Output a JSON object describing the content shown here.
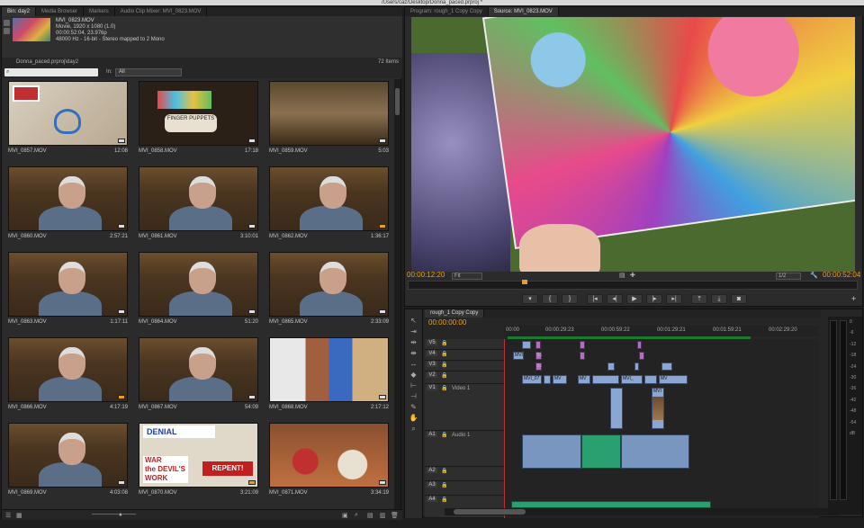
{
  "titlebar": {
    "path": "/Users/caz/Desktop/Donna_paced.prproj *"
  },
  "project_panel": {
    "tabs": [
      "Bin: day2",
      "Media Browser",
      "Markers",
      "Audio Clip Mixer: MVI_0823.MOV"
    ],
    "clip_info": {
      "name": "MVI_0823.MOV",
      "line1": "Movie, 1920 x 1080 (1.0)",
      "line2": "00:00:52:04, 23.976p",
      "line3": "48000 Hz - 16-bit - Stereo mapped to 2 Mono"
    },
    "path": "Donna_paced.prproj\\day2",
    "item_count": "72 Items",
    "search_placeholder": "",
    "in_label": "In:",
    "filter_value": "All",
    "clips": [
      {
        "name": "MVI_0857.MOV",
        "duration": "12:08",
        "kind": "sign"
      },
      {
        "name": "MVI_0858.MOV",
        "duration": "17:18",
        "kind": "puppets"
      },
      {
        "name": "MVI_0859.MOV",
        "duration": "5:03",
        "kind": "shelf"
      },
      {
        "name": "MVI_0860.MOV",
        "duration": "2:57:21",
        "kind": "face"
      },
      {
        "name": "MVI_0861.MOV",
        "duration": "3:10:01",
        "kind": "face"
      },
      {
        "name": "MVI_0862.MOV",
        "duration": "1:36:17",
        "kind": "face"
      },
      {
        "name": "MVI_0863.MOV",
        "duration": "1:17:11",
        "kind": "face"
      },
      {
        "name": "MVI_0864.MOV",
        "duration": "51:20",
        "kind": "face"
      },
      {
        "name": "MVI_0865.MOV",
        "duration": "2:33:09",
        "kind": "face"
      },
      {
        "name": "MVI_0866.MOV",
        "duration": "4:17:19",
        "kind": "face"
      },
      {
        "name": "MVI_0867.MOV",
        "duration": "54:09",
        "kind": "face"
      },
      {
        "name": "MVI_0868.MOV",
        "duration": "2:17:12",
        "kind": "window"
      },
      {
        "name": "MVI_0869.MOV",
        "duration": "4:03:08",
        "kind": "face"
      },
      {
        "name": "MVI_0870.MOV",
        "duration": "3:21:09",
        "kind": "signs"
      },
      {
        "name": "MVI_0871.MOV",
        "duration": "3:34:19",
        "kind": "baskets"
      }
    ],
    "sign_text": {
      "denial": "DENIAL",
      "war": "WAR",
      "devils": "the DEVIL'S",
      "work": "WORK",
      "repent": "REPENT!",
      "puppets": "FINGER PUPPETS"
    }
  },
  "program_monitor": {
    "tabs": [
      "Program: rough_1 Copy Copy",
      "Source: MVI_0823.MOV"
    ],
    "timecode_current": "00:00:12:20",
    "zoom": "Fit",
    "resolution": "1/2",
    "timecode_duration": "00:00:52:04",
    "transport": [
      "▾",
      "{",
      "}",
      "|◂",
      "◂|",
      "▶",
      "|▸",
      "▸|",
      "⤒",
      "⤓",
      "◙"
    ]
  },
  "timeline": {
    "tab": "rough_1 Copy Copy",
    "timecode": "00:00:00:00",
    "ruler": [
      "00:00",
      "00:00:29:23",
      "00:00:59:22",
      "00:01:29:21",
      "00:01:59:21",
      "00:02:29:20"
    ],
    "tracks": [
      {
        "label": "V5",
        "name": ""
      },
      {
        "label": "V4",
        "name": ""
      },
      {
        "label": "V3",
        "name": ""
      },
      {
        "label": "V2",
        "name": ""
      },
      {
        "label": "V1",
        "name": "Video 1"
      },
      {
        "label": "A1",
        "name": "Audio 1"
      },
      {
        "label": "A2",
        "name": ""
      },
      {
        "label": "A3",
        "name": ""
      },
      {
        "label": "A4",
        "name": ""
      }
    ],
    "clip_labels": {
      "v4a": "MVI",
      "v4b": "Sc",
      "v3a": "Sc",
      "v2a": "MVI_07",
      "v2b": "MV",
      "v2c": "MV",
      "v2d": "MVI_",
      "v2e": "MV",
      "v1a": "MVI"
    },
    "meter_scale": [
      "0",
      "-6",
      "-12",
      "-18",
      "-24",
      "-30",
      "-36",
      "-42",
      "-48",
      "-54",
      "dB"
    ]
  },
  "colors": {
    "timecode": "#e8a020",
    "video_clip": "#8ba6d0",
    "audio_clip": "#7896c0",
    "nested_clip": "#b070c0",
    "selected_audio": "#2aa070"
  }
}
